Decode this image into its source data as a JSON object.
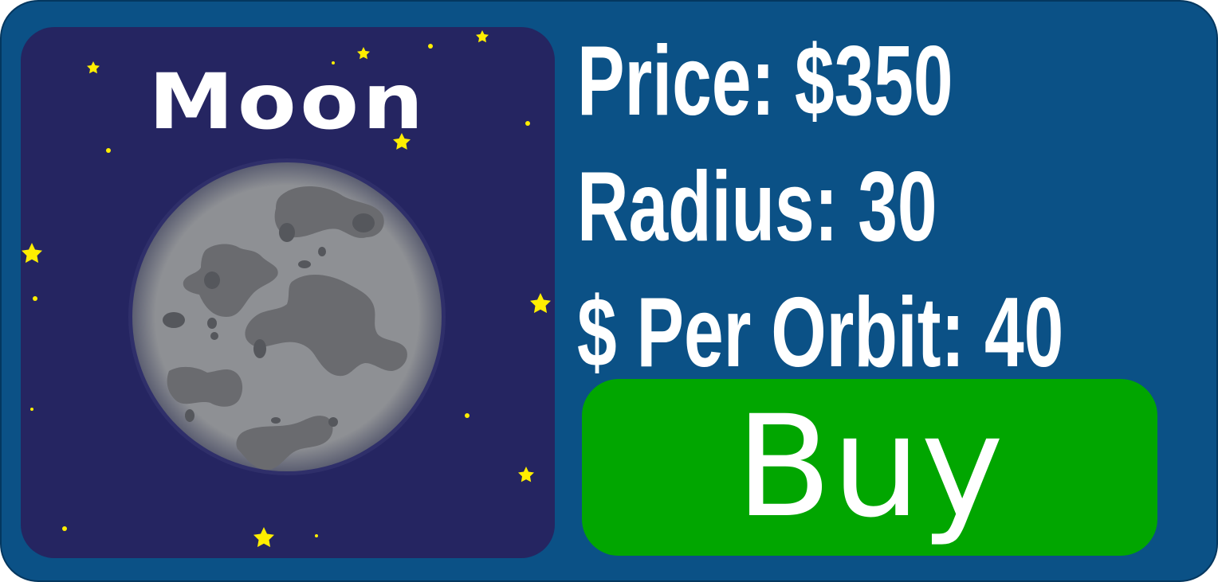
{
  "planet": {
    "name": "Moon",
    "image": "moon-icon"
  },
  "stats": {
    "price": "Price: $350",
    "radius": "Radius: 30",
    "per_orbit": "$ Per Orbit: 40"
  },
  "actions": {
    "buy_label": "Buy"
  },
  "colors": {
    "card": "#0b5186",
    "preview_bg": "#252561",
    "buy_button": "#01a600",
    "star": "#ffee00",
    "moon": "#8f9094"
  }
}
